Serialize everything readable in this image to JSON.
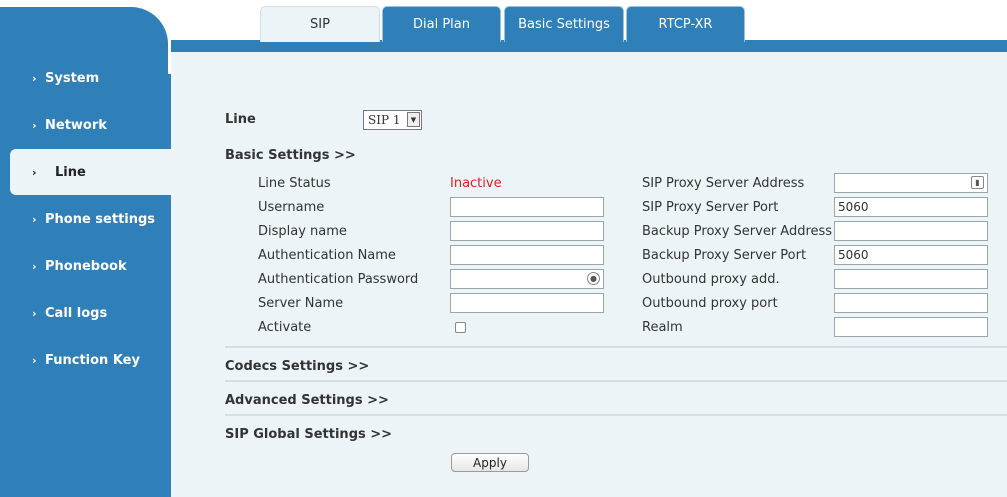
{
  "sidebar": {
    "items": [
      {
        "label": "System"
      },
      {
        "label": "Network"
      },
      {
        "label": "Line"
      },
      {
        "label": "Phone settings"
      },
      {
        "label": "Phonebook"
      },
      {
        "label": "Call logs"
      },
      {
        "label": "Function Key"
      }
    ]
  },
  "tabs": [
    {
      "label": "SIP"
    },
    {
      "label": "Dial Plan"
    },
    {
      "label": "Basic Settings"
    },
    {
      "label": "RTCP-XR"
    }
  ],
  "line": {
    "label": "Line",
    "selected": "SIP 1"
  },
  "sections": {
    "basic": "Basic Settings >>",
    "codecs": "Codecs Settings >>",
    "advanced": "Advanced Settings >>",
    "sip_global": "SIP Global Settings >>"
  },
  "left_fields": {
    "line_status_label": "Line Status",
    "line_status_value": "Inactive",
    "username_label": "Username",
    "username_value": "",
    "display_name_label": "Display name",
    "display_name_value": "",
    "auth_name_label": "Authentication Name",
    "auth_name_value": "",
    "auth_password_label": "Authentication Password",
    "auth_password_value": "",
    "server_name_label": "Server Name",
    "server_name_value": "",
    "activate_label": "Activate"
  },
  "right_fields": {
    "proxy_address_label": "SIP Proxy Server Address",
    "proxy_address_value": "",
    "proxy_port_label": "SIP Proxy Server Port",
    "proxy_port_value": "5060",
    "backup_address_label": "Backup Proxy Server Address",
    "backup_address_value": "",
    "backup_port_label": "Backup Proxy Server Port",
    "backup_port_value": "5060",
    "outbound_add_label": "Outbound proxy add.",
    "outbound_add_value": "",
    "outbound_port_label": "Outbound proxy port",
    "outbound_port_value": "",
    "realm_label": "Realm",
    "realm_value": ""
  },
  "apply_label": "Apply",
  "colors": {
    "accent": "#2f80b9",
    "content_bg": "#ecf4f8",
    "status_inactive": "#e02020"
  }
}
